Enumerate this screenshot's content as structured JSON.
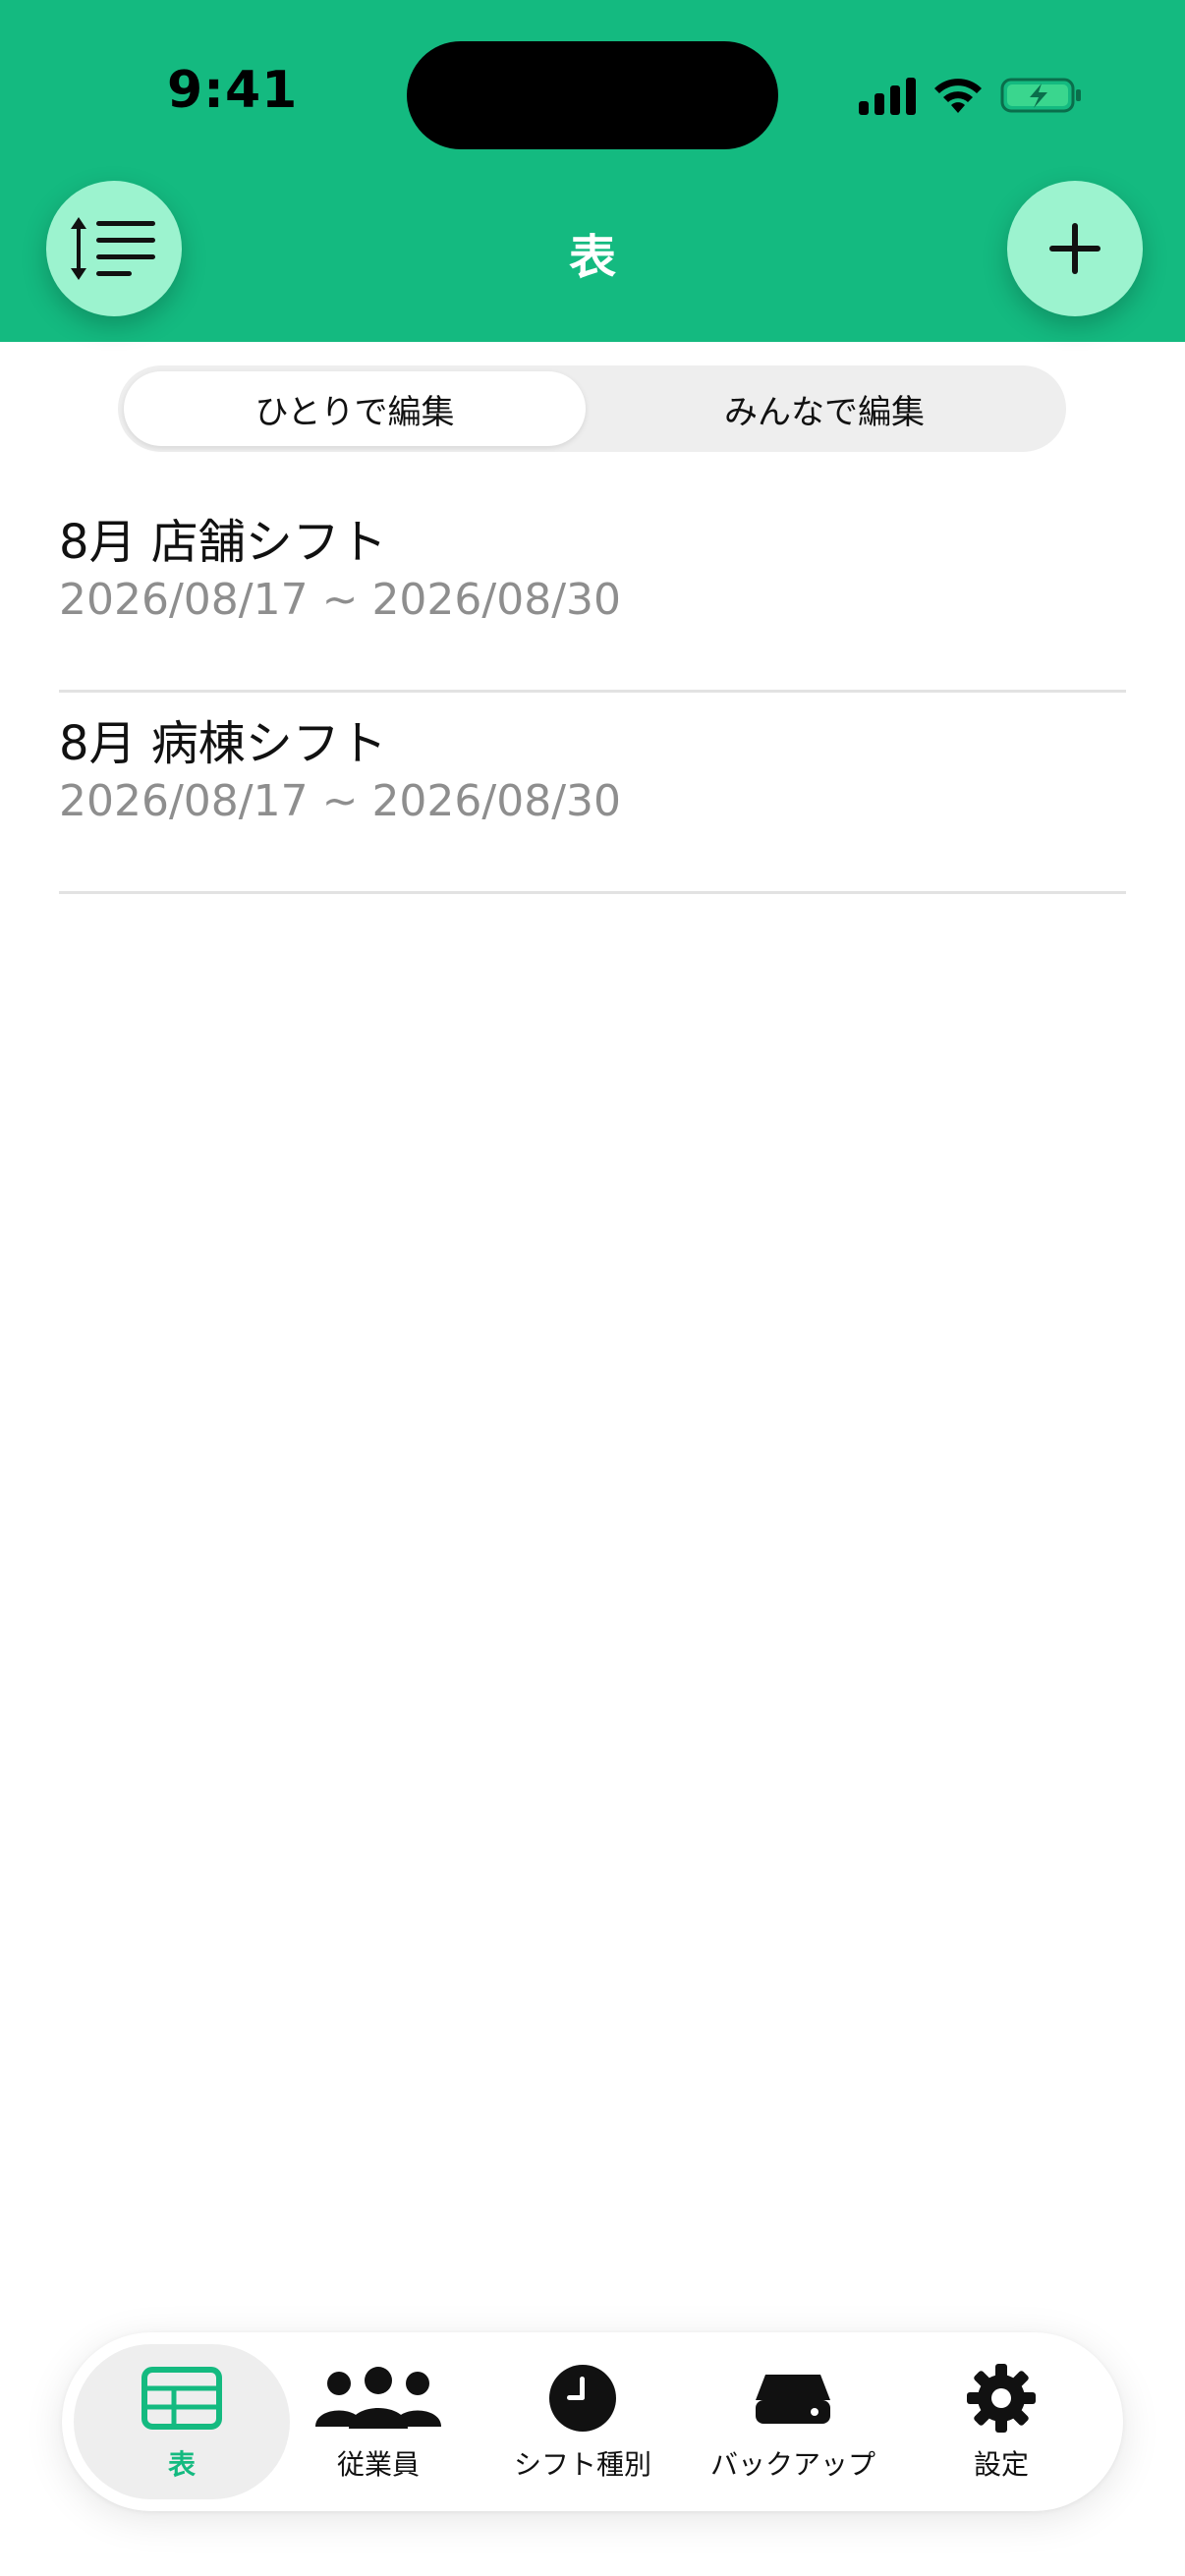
{
  "status_bar": {
    "time": "9:41"
  },
  "header": {
    "title": "表"
  },
  "segmented": {
    "options": [
      "ひとりで編集",
      "みんなで編集"
    ],
    "selected": "ひとりで編集"
  },
  "list": {
    "items": [
      {
        "title": "8月 店舗シフト",
        "range": "2026/08/17 ~ 2026/08/30"
      },
      {
        "title": "8月 病棟シフト",
        "range": "2026/08/17 ~ 2026/08/30"
      }
    ]
  },
  "tabbar": {
    "tabs": [
      {
        "label": "表",
        "icon": "table-icon",
        "active": true
      },
      {
        "label": "従業員",
        "icon": "people-icon",
        "active": false
      },
      {
        "label": "シフト種別",
        "icon": "clock-icon",
        "active": false
      },
      {
        "label": "バックアップ",
        "icon": "drive-icon",
        "active": false
      },
      {
        "label": "設定",
        "icon": "gear-icon",
        "active": false
      }
    ]
  },
  "colors": {
    "accent": "#14ba80",
    "button": "#9cf3cf"
  }
}
